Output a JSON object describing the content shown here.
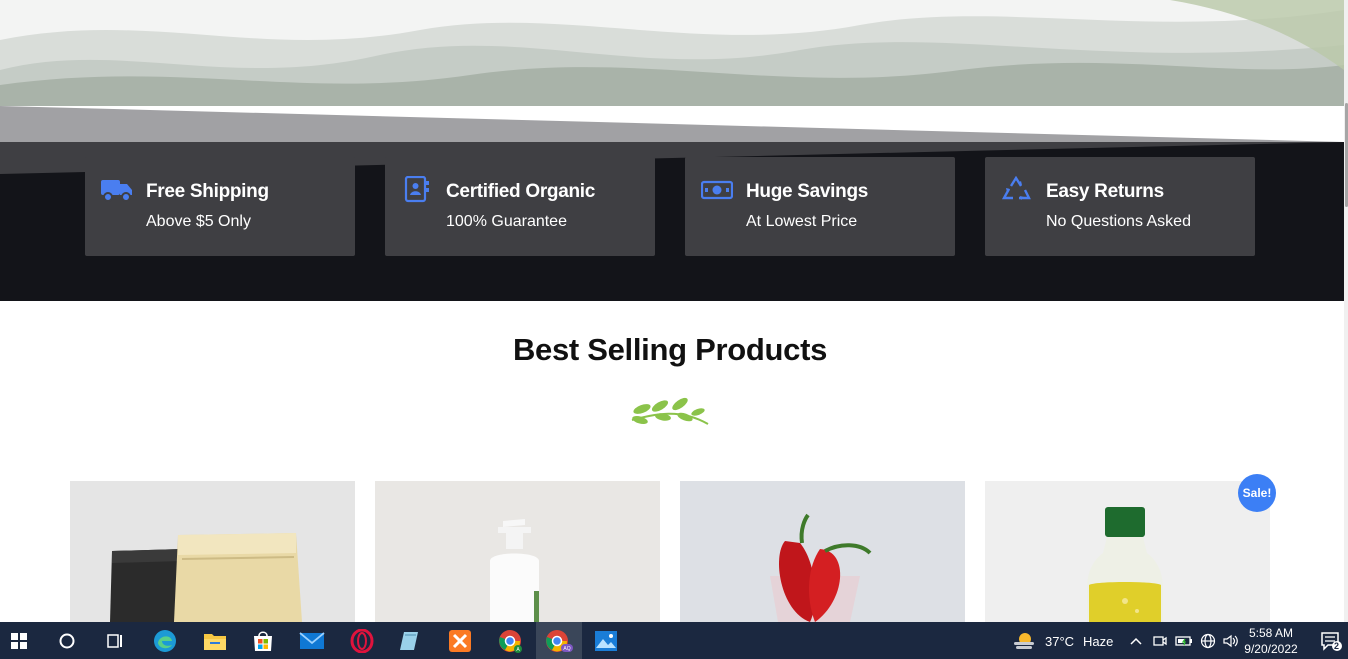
{
  "features": [
    {
      "title": "Free Shipping",
      "subtitle": "Above $5 Only",
      "icon": "truck-icon"
    },
    {
      "title": "Certified Organic",
      "subtitle": "100% Guarantee",
      "icon": "contact-book-icon"
    },
    {
      "title": "Huge Savings",
      "subtitle": "At Lowest Price",
      "icon": "money-bill-icon"
    },
    {
      "title": "Easy Returns",
      "subtitle": "No Questions Asked",
      "icon": "recycle-icon"
    }
  ],
  "section": {
    "title": "Best Selling Products",
    "decoration": "leaf-branch-icon"
  },
  "products": [
    {
      "image": "coffee-bags-image"
    },
    {
      "image": "lotion-bottle-image"
    },
    {
      "image": "red-peppers-image"
    },
    {
      "image": "oil-bottle-image",
      "badge": "Sale!"
    }
  ],
  "taskbar": {
    "apps": [
      "windows-start-icon",
      "cortana-search-icon",
      "task-view-icon",
      "edge-icon",
      "file-explorer-icon",
      "microsoft-store-icon",
      "mail-icon",
      "opera-icon",
      "notepad-icon",
      "xampp-icon",
      "chrome-icon",
      "chrome-profile-icon",
      "photos-icon"
    ],
    "weather": {
      "temp": "37°C",
      "condition": "Haze"
    },
    "clock": {
      "time": "5:58 AM",
      "date": "9/20/2022"
    },
    "notifications": "2"
  },
  "colors": {
    "accent": "#3c7ff5",
    "dark_band": "#131419",
    "feature_card": "#3f3f43",
    "taskbar": "#1b2840",
    "leaf": "#8bc34a"
  }
}
